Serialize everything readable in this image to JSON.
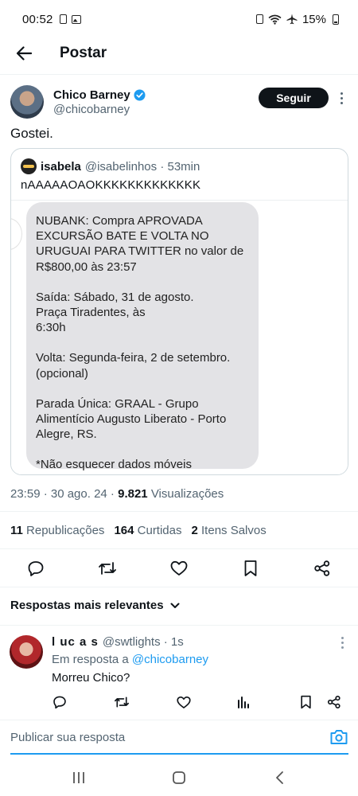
{
  "status_bar": {
    "time": "00:52",
    "battery": "15%"
  },
  "header": {
    "title": "Postar"
  },
  "post": {
    "author_name": "Chico Barney",
    "author_handle": "@chicobarney",
    "follow_label": "Seguir",
    "text": "Gostei.",
    "timestamp": "23:59 · 30 ago. 24 · ",
    "views_count": "9.821",
    "views_label": " Visualizações"
  },
  "quoted_post": {
    "author_name": "isabela",
    "meta": "@isabelinhos · 53min",
    "text": "nAAAAAOAOKKKKKKKKKKKKK",
    "image_message": {
      "paragraph_1": "NUBANK: Compra APROVADA EXCURSÃO BATE E VOLTA NO URUGUAI PARA TWITTER no valor de R$800,00 às 23:57",
      "paragraph_2": "Saída: Sábado, 31 de agosto.\nPraça Tiradentes, às\n6:30h",
      "paragraph_3": "Volta: Segunda-feira, 2 de setembro.\n(opcional)",
      "paragraph_4": "Parada Única: GRAAL - Grupo Alimentício Augusto Liberato - Porto Alegre, RS.",
      "paragraph_5": "*Não esquecer dados móveis"
    }
  },
  "stats": {
    "reposts_count": "11",
    "reposts_label": "Republicações",
    "likes_count": "164",
    "likes_label": "Curtidas",
    "saves_count": "2",
    "saves_label": "Itens Salvos"
  },
  "replies_sort": {
    "label": "Respostas mais relevantes"
  },
  "reply": {
    "author_name": "l uc a s",
    "meta": "@swtlights · 1s",
    "in_reply_prefix": "Em resposta a ",
    "in_reply_handle": "@chicobarney",
    "text": "Morreu Chico?"
  },
  "composer": {
    "placeholder": "Publicar sua resposta"
  },
  "colors": {
    "accent": "#1d9bf0",
    "text": "#0f1419",
    "secondary": "#536471",
    "bubble": "#e3e3e6"
  },
  "icons": [
    "back-arrow-icon",
    "verified-badge-icon",
    "more-icon",
    "reply-icon",
    "repost-icon",
    "like-icon",
    "bookmark-icon",
    "share-icon",
    "chevron-down-icon",
    "views-icon",
    "camera-icon",
    "recents-icon",
    "home-icon",
    "back-nav-icon"
  ]
}
